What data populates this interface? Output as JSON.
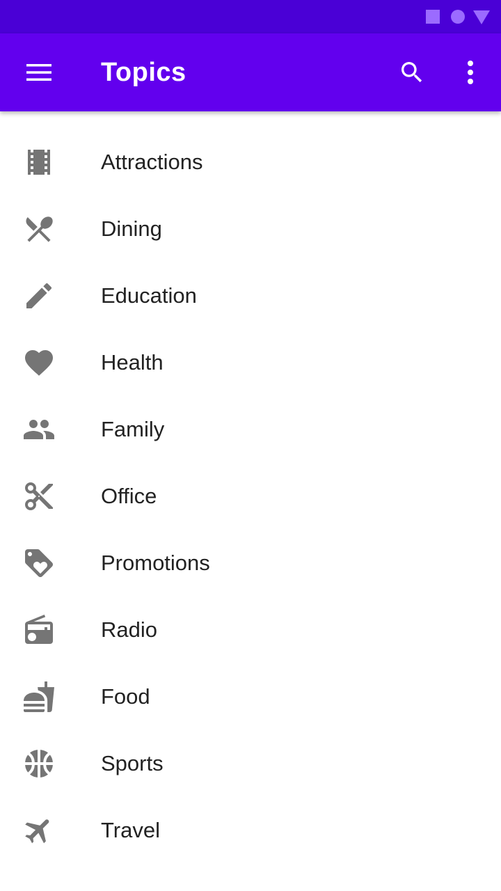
{
  "status_bar": {
    "icons": [
      "square-icon",
      "circle-icon",
      "triangle-icon"
    ],
    "color": "#9b6bff",
    "background": "#4a00d6"
  },
  "app_bar": {
    "title": "Topics",
    "background": "#6200ee",
    "actions": [
      "menu-icon",
      "search-icon",
      "more-vert-icon"
    ]
  },
  "topics": [
    {
      "label": "Attractions",
      "icon": "movie-film-icon"
    },
    {
      "label": "Dining",
      "icon": "restaurant-icon"
    },
    {
      "label": "Education",
      "icon": "pencil-icon"
    },
    {
      "label": "Health",
      "icon": "heart-icon"
    },
    {
      "label": "Family",
      "icon": "people-icon"
    },
    {
      "label": "Office",
      "icon": "scissors-icon"
    },
    {
      "label": "Promotions",
      "icon": "tag-heart-icon"
    },
    {
      "label": "Radio",
      "icon": "radio-icon"
    },
    {
      "label": "Food",
      "icon": "fastfood-icon"
    },
    {
      "label": "Sports",
      "icon": "basketball-icon"
    },
    {
      "label": "Travel",
      "icon": "airplane-icon"
    }
  ],
  "colors": {
    "icon": "#757575",
    "text": "#222222"
  }
}
